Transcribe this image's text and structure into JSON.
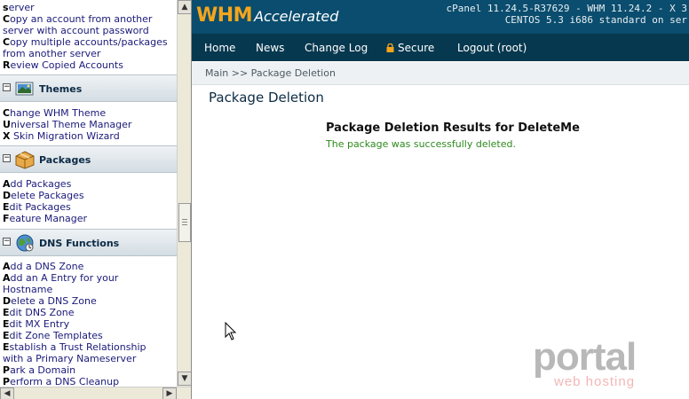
{
  "sidebar": {
    "top_items": [
      {
        "label": "server"
      },
      {
        "label": "Copy an account from another"
      },
      {
        "label": "server with account password"
      },
      {
        "label": "Copy multiple accounts/packages"
      },
      {
        "label": "from another server"
      },
      {
        "label": "Review Copied Accounts"
      }
    ],
    "sections": [
      {
        "title": "Themes",
        "icon": "themes-icon",
        "items": [
          {
            "label": "Change WHM Theme"
          },
          {
            "label": "Universal Theme Manager"
          },
          {
            "label": "X Skin Migration Wizard"
          }
        ]
      },
      {
        "title": "Packages",
        "icon": "packages-icon",
        "items": [
          {
            "label": "Add Packages"
          },
          {
            "label": "Delete Packages"
          },
          {
            "label": "Edit Packages"
          },
          {
            "label": "Feature Manager"
          }
        ]
      },
      {
        "title": "DNS Functions",
        "icon": "dns-functions-icon",
        "items": [
          {
            "label": "Add a DNS Zone"
          },
          {
            "label": "Add an A Entry for your"
          },
          {
            "label": "Hostname"
          },
          {
            "label": "Delete a DNS Zone"
          },
          {
            "label": "Edit DNS Zone"
          },
          {
            "label": "Edit MX Entry"
          },
          {
            "label": "Edit Zone Templates"
          },
          {
            "label": "Establish a Trust Relationship"
          },
          {
            "label": "with a Primary Nameserver"
          },
          {
            "label": "Park a Domain"
          },
          {
            "label": "Perform a DNS Cleanup"
          }
        ]
      }
    ]
  },
  "header": {
    "logo_main": "WHM",
    "logo_sub": "Accelerated",
    "version_line1": "cPanel 11.24.5-R37629 - WHM 11.24.2 - X 3",
    "version_line2": "CENTOS 5.3 i686 standard on ser"
  },
  "nav": {
    "items": [
      {
        "label": "Home"
      },
      {
        "label": "News"
      },
      {
        "label": "Change Log"
      },
      {
        "label": "Secure"
      },
      {
        "label": "Logout (root)"
      }
    ]
  },
  "breadcrumb": "Main >> Package Deletion",
  "page": {
    "title": "Package Deletion",
    "results_title": "Package Deletion Results for DeleteMe",
    "results_message": "The package was successfully deleted."
  },
  "watermark": {
    "brand": "portal",
    "tagline": "web hosting"
  },
  "colors": {
    "header_bg": "#0a4d6e",
    "nav_bg": "#06384f",
    "logo_orange": "#f5a51c",
    "success_green": "#2e8a1d",
    "link_blue": "#1a1a7a"
  }
}
